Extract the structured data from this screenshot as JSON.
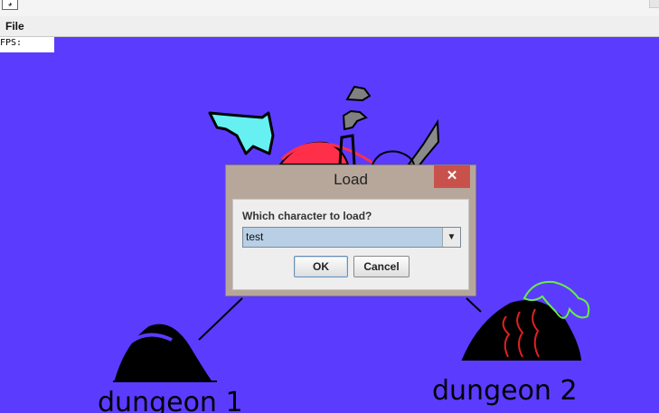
{
  "window": {
    "icon_glyph": "◕",
    "menu": {
      "file_label": "File"
    }
  },
  "hud": {
    "fps_label": "FPS:"
  },
  "map": {
    "background_color": "#5b3cff",
    "labels": {
      "dungeon1": "dungeon 1",
      "dungeon2": "dungeon 2"
    }
  },
  "dialog": {
    "title": "Load",
    "close_glyph": "✕",
    "prompt": "Which character to load?",
    "combo_value": "test",
    "ok_label": "OK",
    "cancel_label": "Cancel",
    "close_color": "#c8524b",
    "frame_color": "#b7a79a"
  }
}
